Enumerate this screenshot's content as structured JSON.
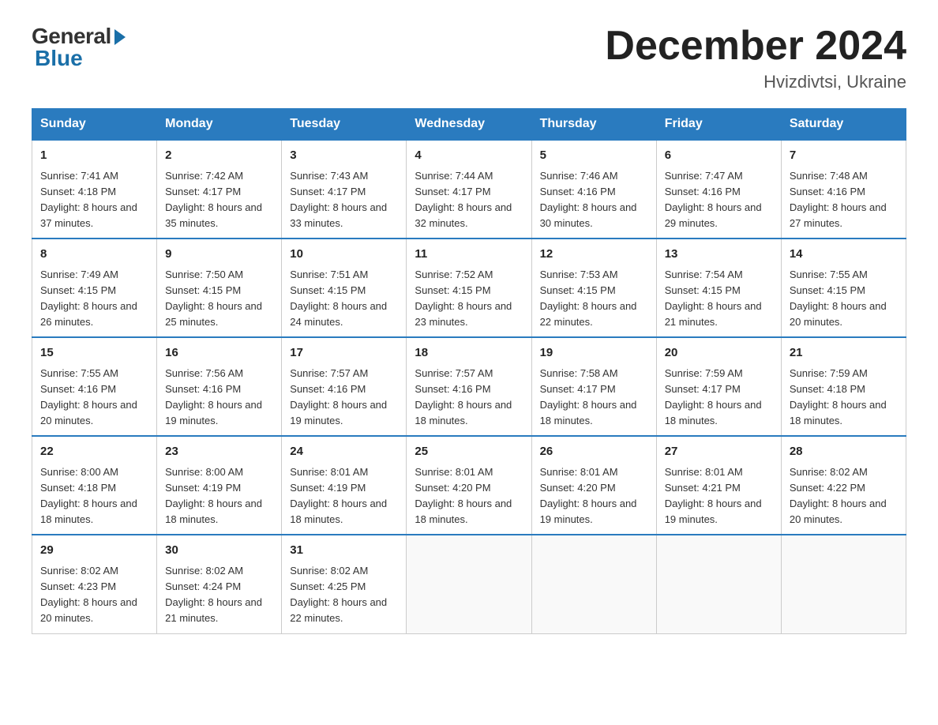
{
  "header": {
    "logo_general": "General",
    "logo_blue": "Blue",
    "month_title": "December 2024",
    "location": "Hvizdivtsi, Ukraine"
  },
  "weekdays": [
    "Sunday",
    "Monday",
    "Tuesday",
    "Wednesday",
    "Thursday",
    "Friday",
    "Saturday"
  ],
  "weeks": [
    [
      {
        "day": "1",
        "sunrise": "7:41 AM",
        "sunset": "4:18 PM",
        "daylight": "8 hours and 37 minutes."
      },
      {
        "day": "2",
        "sunrise": "7:42 AM",
        "sunset": "4:17 PM",
        "daylight": "8 hours and 35 minutes."
      },
      {
        "day": "3",
        "sunrise": "7:43 AM",
        "sunset": "4:17 PM",
        "daylight": "8 hours and 33 minutes."
      },
      {
        "day": "4",
        "sunrise": "7:44 AM",
        "sunset": "4:17 PM",
        "daylight": "8 hours and 32 minutes."
      },
      {
        "day": "5",
        "sunrise": "7:46 AM",
        "sunset": "4:16 PM",
        "daylight": "8 hours and 30 minutes."
      },
      {
        "day": "6",
        "sunrise": "7:47 AM",
        "sunset": "4:16 PM",
        "daylight": "8 hours and 29 minutes."
      },
      {
        "day": "7",
        "sunrise": "7:48 AM",
        "sunset": "4:16 PM",
        "daylight": "8 hours and 27 minutes."
      }
    ],
    [
      {
        "day": "8",
        "sunrise": "7:49 AM",
        "sunset": "4:15 PM",
        "daylight": "8 hours and 26 minutes."
      },
      {
        "day": "9",
        "sunrise": "7:50 AM",
        "sunset": "4:15 PM",
        "daylight": "8 hours and 25 minutes."
      },
      {
        "day": "10",
        "sunrise": "7:51 AM",
        "sunset": "4:15 PM",
        "daylight": "8 hours and 24 minutes."
      },
      {
        "day": "11",
        "sunrise": "7:52 AM",
        "sunset": "4:15 PM",
        "daylight": "8 hours and 23 minutes."
      },
      {
        "day": "12",
        "sunrise": "7:53 AM",
        "sunset": "4:15 PM",
        "daylight": "8 hours and 22 minutes."
      },
      {
        "day": "13",
        "sunrise": "7:54 AM",
        "sunset": "4:15 PM",
        "daylight": "8 hours and 21 minutes."
      },
      {
        "day": "14",
        "sunrise": "7:55 AM",
        "sunset": "4:15 PM",
        "daylight": "8 hours and 20 minutes."
      }
    ],
    [
      {
        "day": "15",
        "sunrise": "7:55 AM",
        "sunset": "4:16 PM",
        "daylight": "8 hours and 20 minutes."
      },
      {
        "day": "16",
        "sunrise": "7:56 AM",
        "sunset": "4:16 PM",
        "daylight": "8 hours and 19 minutes."
      },
      {
        "day": "17",
        "sunrise": "7:57 AM",
        "sunset": "4:16 PM",
        "daylight": "8 hours and 19 minutes."
      },
      {
        "day": "18",
        "sunrise": "7:57 AM",
        "sunset": "4:16 PM",
        "daylight": "8 hours and 18 minutes."
      },
      {
        "day": "19",
        "sunrise": "7:58 AM",
        "sunset": "4:17 PM",
        "daylight": "8 hours and 18 minutes."
      },
      {
        "day": "20",
        "sunrise": "7:59 AM",
        "sunset": "4:17 PM",
        "daylight": "8 hours and 18 minutes."
      },
      {
        "day": "21",
        "sunrise": "7:59 AM",
        "sunset": "4:18 PM",
        "daylight": "8 hours and 18 minutes."
      }
    ],
    [
      {
        "day": "22",
        "sunrise": "8:00 AM",
        "sunset": "4:18 PM",
        "daylight": "8 hours and 18 minutes."
      },
      {
        "day": "23",
        "sunrise": "8:00 AM",
        "sunset": "4:19 PM",
        "daylight": "8 hours and 18 minutes."
      },
      {
        "day": "24",
        "sunrise": "8:01 AM",
        "sunset": "4:19 PM",
        "daylight": "8 hours and 18 minutes."
      },
      {
        "day": "25",
        "sunrise": "8:01 AM",
        "sunset": "4:20 PM",
        "daylight": "8 hours and 18 minutes."
      },
      {
        "day": "26",
        "sunrise": "8:01 AM",
        "sunset": "4:20 PM",
        "daylight": "8 hours and 19 minutes."
      },
      {
        "day": "27",
        "sunrise": "8:01 AM",
        "sunset": "4:21 PM",
        "daylight": "8 hours and 19 minutes."
      },
      {
        "day": "28",
        "sunrise": "8:02 AM",
        "sunset": "4:22 PM",
        "daylight": "8 hours and 20 minutes."
      }
    ],
    [
      {
        "day": "29",
        "sunrise": "8:02 AM",
        "sunset": "4:23 PM",
        "daylight": "8 hours and 20 minutes."
      },
      {
        "day": "30",
        "sunrise": "8:02 AM",
        "sunset": "4:24 PM",
        "daylight": "8 hours and 21 minutes."
      },
      {
        "day": "31",
        "sunrise": "8:02 AM",
        "sunset": "4:25 PM",
        "daylight": "8 hours and 22 minutes."
      },
      null,
      null,
      null,
      null
    ]
  ],
  "labels": {
    "sunrise": "Sunrise:",
    "sunset": "Sunset:",
    "daylight": "Daylight:"
  }
}
